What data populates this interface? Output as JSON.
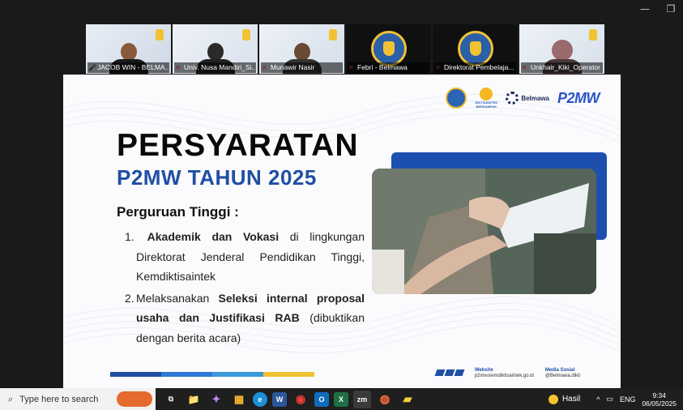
{
  "window": {
    "minimize_glyph": "—",
    "restore_glyph": "❐"
  },
  "participants": [
    {
      "name": "JACOB WIN - BELMA...",
      "muted": false,
      "active": true
    },
    {
      "name": "Univ. Nusa Mandiri_Si...",
      "muted": true,
      "active": false
    },
    {
      "name": "Munawir Nasir",
      "muted": true,
      "active": false
    },
    {
      "name": "Febri - Belmawa",
      "muted": true,
      "active": false
    },
    {
      "name": "Direktorat Pembelaja...",
      "muted": true,
      "active": false
    },
    {
      "name": "Unkhair_Kiki_Operator",
      "muted": true,
      "active": false
    }
  ],
  "slide": {
    "logos": {
      "dikti_text": "DIKTISAINTEK BERDAMPAK",
      "belmawa": "Belmawa",
      "p2mw": "P2MW"
    },
    "title": "PERSYARATAN",
    "subtitle": "P2MW TAHUN 2025",
    "section_heading": "Perguruan Tinggi :",
    "requirements": [
      {
        "num": "1.",
        "bold_part": "Akademik dan Vokasi",
        "rest": " di lingkungan Direktorat Jenderal Pendidikan Tinggi, Kemdiktisaintek"
      },
      {
        "num": "2.",
        "lead": "Melaksanakan ",
        "bold_part": "Seleksi internal proposal usaha dan Justifikasi RAB",
        "rest": " (dibuktikan dengan berita acara)"
      }
    ],
    "footer": {
      "website_label": "Website",
      "website_value": "p2mw.kemdiktisaintek.go.id",
      "social_label": "Media Sosial",
      "social_value": "@Belmawa.dikti"
    },
    "colors": {
      "title_blue": "#1f4fa3",
      "stripe": [
        "#1f4fa3",
        "#2c7ad6",
        "#3a9ad9",
        "#f1c232"
      ]
    }
  },
  "taskbar": {
    "search_placeholder": "Type here to search",
    "apps": [
      {
        "name": "task-view",
        "glyph": "⧉"
      },
      {
        "name": "file-explorer",
        "glyph": "📁"
      },
      {
        "name": "copilot",
        "glyph": "✦"
      },
      {
        "name": "microsoft-store",
        "glyph": "▦"
      },
      {
        "name": "edge",
        "glyph": "e"
      },
      {
        "name": "word",
        "glyph": "W"
      },
      {
        "name": "chrome",
        "glyph": "◉"
      },
      {
        "name": "outlook",
        "glyph": "O"
      },
      {
        "name": "excel",
        "glyph": "X"
      },
      {
        "name": "zoom",
        "glyph": "zm"
      },
      {
        "name": "firefox",
        "glyph": "◍"
      },
      {
        "name": "sticky-notes",
        "glyph": "▰"
      }
    ],
    "weather": "Hasil",
    "tray_arrow": "^",
    "language": "ENG",
    "time": "9:34",
    "date": "06/05/2025"
  }
}
